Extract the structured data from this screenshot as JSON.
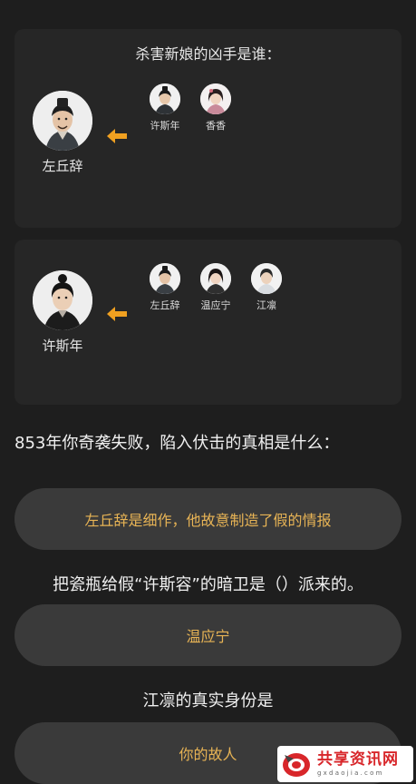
{
  "card1": {
    "title": "杀害新娘的凶手是谁：",
    "main_character": {
      "name": "左丘辞",
      "icon": "male-portrait-hat"
    },
    "candidates": [
      {
        "name": "许斯年",
        "icon": "male-portrait"
      },
      {
        "name": "香香",
        "icon": "female-portrait"
      }
    ]
  },
  "card2": {
    "main_character": {
      "name": "许斯年",
      "icon": "male-portrait-topknot"
    },
    "candidates": [
      {
        "name": "左丘辞",
        "icon": "male-portrait"
      },
      {
        "name": "温应宁",
        "icon": "female-portrait"
      },
      {
        "name": "江凛",
        "icon": "male-portrait-white"
      }
    ]
  },
  "arrow_icon": "arrow-left-icon",
  "questions": [
    {
      "text": "853年你奇袭失败，陷入伏击的真相是什么：",
      "answer": "左丘辞是细作，他故意制造了假的情报"
    },
    {
      "text": "把瓷瓶给假“许斯容”的暗卫是（）派来的。",
      "answer": "温应宁"
    },
    {
      "text": "江凛的真实身份是",
      "answer": "你的故人"
    }
  ],
  "watermark": {
    "title": "共享资讯网",
    "sub": "g x d a o j i a . c o m"
  },
  "colors": {
    "background": "#1e1e1e",
    "card": "#262626",
    "button": "#3a3a3a",
    "answer_text": "#e8b455",
    "arrow": "#f0a020",
    "watermark_red": "#d8262a"
  }
}
